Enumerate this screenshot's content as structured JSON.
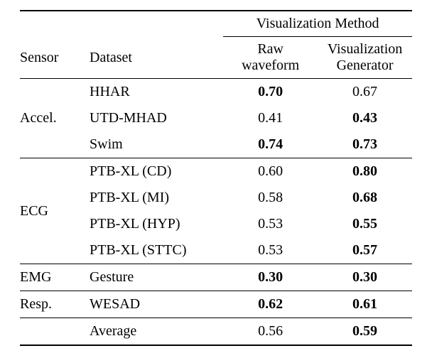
{
  "header": {
    "sensor": "Sensor",
    "dataset": "Dataset",
    "spanner": "Visualization Method",
    "raw_l1": "Raw",
    "raw_l2": "waveform",
    "vis_l1": "Visualization",
    "vis_l2": "Generator"
  },
  "groups": {
    "accel": {
      "label": "Accel."
    },
    "ecg": {
      "label": "ECG"
    },
    "emg": {
      "label": "EMG"
    },
    "resp": {
      "label": "Resp."
    }
  },
  "rows": {
    "hhar": {
      "dataset": "HHAR",
      "raw": "0.70",
      "vis": "0.67"
    },
    "utd": {
      "dataset": "UTD-MHAD",
      "raw": "0.41",
      "vis": "0.43"
    },
    "swim": {
      "dataset": "Swim",
      "raw": "0.74",
      "vis": "0.73"
    },
    "cd": {
      "dataset": "PTB-XL (CD)",
      "raw": "0.60",
      "vis": "0.80"
    },
    "mi": {
      "dataset": "PTB-XL (MI)",
      "raw": "0.58",
      "vis": "0.68"
    },
    "hyp": {
      "dataset": "PTB-XL (HYP)",
      "raw": "0.53",
      "vis": "0.55"
    },
    "sttc": {
      "dataset": "PTB-XL (STTC)",
      "raw": "0.53",
      "vis": "0.57"
    },
    "gesture": {
      "dataset": "Gesture",
      "raw": "0.30",
      "vis": "0.30"
    },
    "wesad": {
      "dataset": "WESAD",
      "raw": "0.62",
      "vis": "0.61"
    }
  },
  "footer": {
    "label": "Average",
    "raw": "0.56",
    "vis": "0.59"
  },
  "chart_data": {
    "type": "table",
    "title": "Visualization Method comparison",
    "columns": [
      "Sensor",
      "Dataset",
      "Raw waveform",
      "Visualization Generator"
    ],
    "rows": [
      {
        "sensor": "Accel.",
        "dataset": "HHAR",
        "raw": 0.7,
        "vis": 0.67,
        "bold": "raw"
      },
      {
        "sensor": "Accel.",
        "dataset": "UTD-MHAD",
        "raw": 0.41,
        "vis": 0.43,
        "bold": "vis"
      },
      {
        "sensor": "Accel.",
        "dataset": "Swim",
        "raw": 0.74,
        "vis": 0.73,
        "bold": "both"
      },
      {
        "sensor": "ECG",
        "dataset": "PTB-XL (CD)",
        "raw": 0.6,
        "vis": 0.8,
        "bold": "vis"
      },
      {
        "sensor": "ECG",
        "dataset": "PTB-XL (MI)",
        "raw": 0.58,
        "vis": 0.68,
        "bold": "vis"
      },
      {
        "sensor": "ECG",
        "dataset": "PTB-XL (HYP)",
        "raw": 0.53,
        "vis": 0.55,
        "bold": "vis"
      },
      {
        "sensor": "ECG",
        "dataset": "PTB-XL (STTC)",
        "raw": 0.53,
        "vis": 0.57,
        "bold": "vis"
      },
      {
        "sensor": "EMG",
        "dataset": "Gesture",
        "raw": 0.3,
        "vis": 0.3,
        "bold": "both"
      },
      {
        "sensor": "Resp.",
        "dataset": "WESAD",
        "raw": 0.62,
        "vis": 0.61,
        "bold": "both"
      }
    ],
    "average": {
      "raw": 0.56,
      "vis": 0.59,
      "bold": "vis"
    }
  }
}
